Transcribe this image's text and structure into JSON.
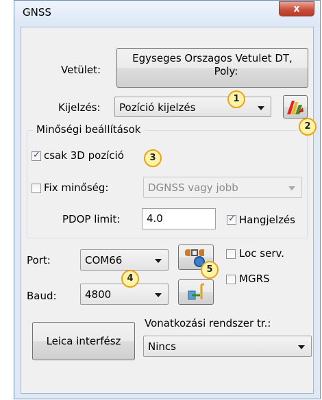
{
  "window": {
    "title": "GNSS",
    "close_glyph": "x"
  },
  "projection": {
    "label": "Vetület:",
    "value_line1": "Egyseges Orszagos Vetulet DT,",
    "value_line2": "Poly:"
  },
  "display": {
    "label": "Kijelzés:",
    "selected": "Pozíció kijelzés",
    "icon": "map-layers-icon"
  },
  "quality_group": {
    "title": "Minőségi beállítások",
    "only_3d": {
      "label": "csak 3D pozíció",
      "checked": true
    },
    "fix_quality": {
      "label": "Fix minőség:",
      "checked": false,
      "selected": "DGNSS vagy jobb"
    },
    "pdop": {
      "label": "PDOP limit:",
      "value": "4.0"
    },
    "sound": {
      "label": "Hangjelzés",
      "checked": true
    }
  },
  "port": {
    "label": "Port:",
    "selected": "COM66",
    "search_icon": "port-search-icon"
  },
  "baud": {
    "label": "Baud:",
    "selected": "4800",
    "connect_icon": "connect-icon"
  },
  "loc_serv": {
    "label": "Loc serv.",
    "checked": false
  },
  "mgrs": {
    "label": "MGRS",
    "checked": false
  },
  "leica_button": {
    "label": "Leica interfész"
  },
  "reference": {
    "label": "Vonatkozási rendszer tr.:",
    "selected": "Nincs"
  },
  "badges": [
    "1",
    "2",
    "3",
    "4",
    "5"
  ],
  "colors": {
    "badge_border": "#e8a31a",
    "badge_fill": "#fff3a8",
    "close_red": "#c8503c",
    "frame": "#dfe9f6"
  }
}
